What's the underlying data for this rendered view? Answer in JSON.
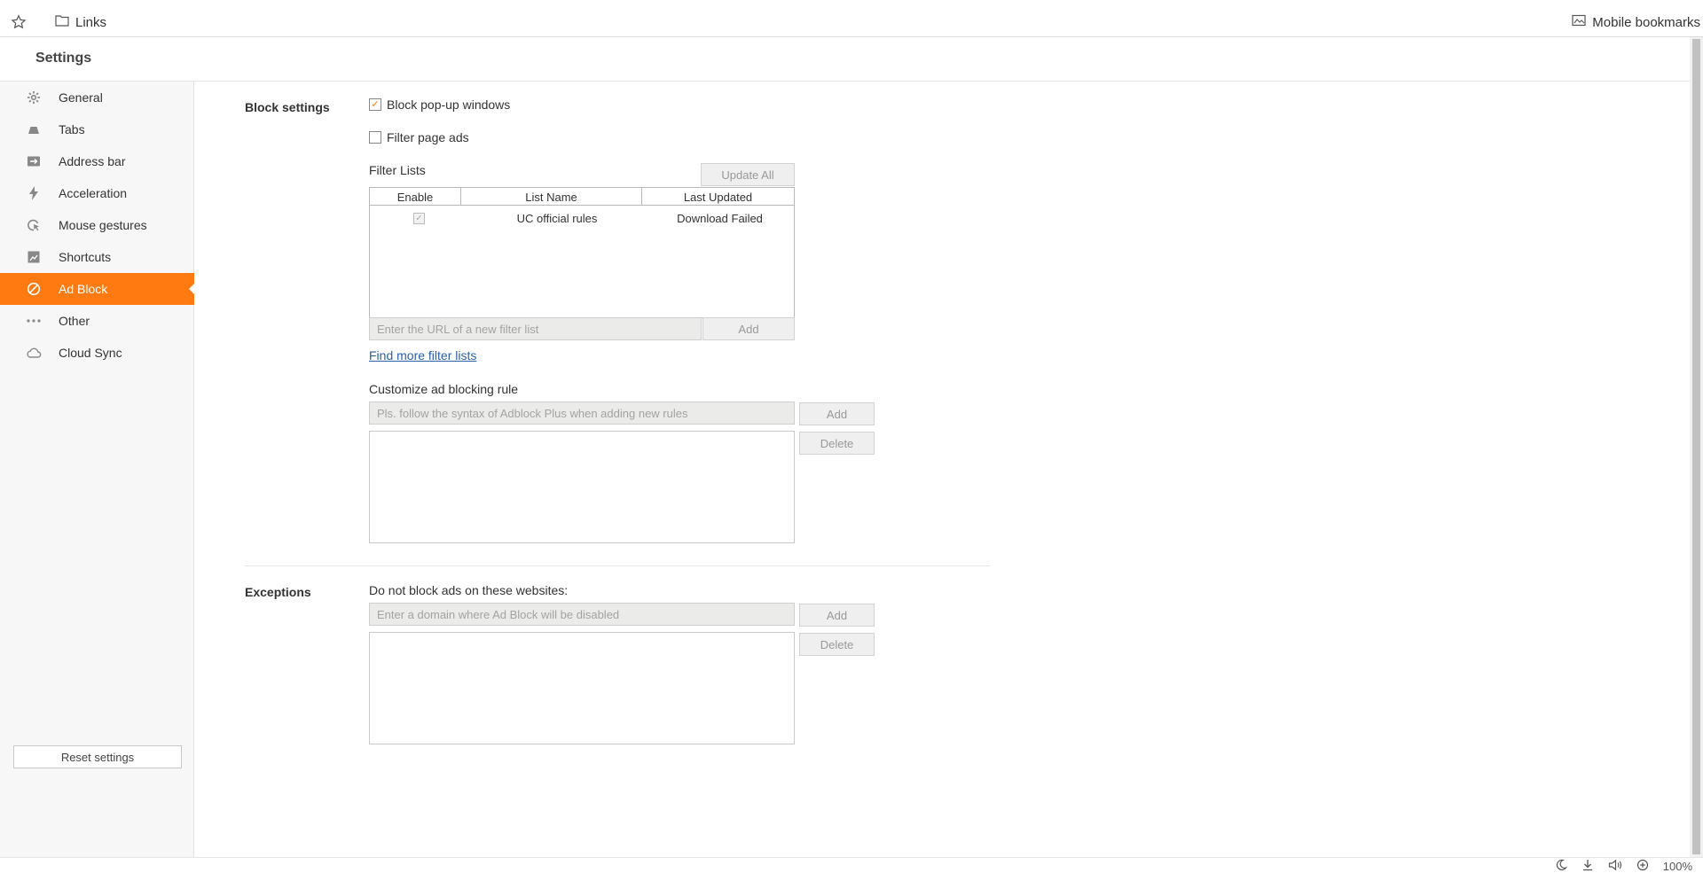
{
  "bookmarks_bar": {
    "links_label": "Links",
    "mobile_label": "Mobile bookmarks"
  },
  "settings": {
    "title": "Settings"
  },
  "sidebar": {
    "items": [
      {
        "label": "General",
        "icon": "gear-icon"
      },
      {
        "label": "Tabs",
        "icon": "tabs-icon"
      },
      {
        "label": "Address bar",
        "icon": "address-bar-icon"
      },
      {
        "label": "Acceleration",
        "icon": "lightning-icon"
      },
      {
        "label": "Mouse gestures",
        "icon": "mouse-gesture-icon"
      },
      {
        "label": "Shortcuts",
        "icon": "shortcuts-icon"
      },
      {
        "label": "Ad Block",
        "icon": "block-icon",
        "active": true
      },
      {
        "label": "Other",
        "icon": "more-icon"
      },
      {
        "label": "Cloud Sync",
        "icon": "cloud-icon"
      }
    ],
    "reset_label": "Reset settings"
  },
  "block_settings": {
    "title": "Block settings",
    "popup_label": "Block pop-up windows",
    "popup_checked": true,
    "filter_ads_label": "Filter page ads",
    "filter_ads_checked": false,
    "filter_lists_label": "Filter Lists",
    "update_all_label": "Update All",
    "table": {
      "headers": [
        "Enable",
        "List Name",
        "Last Updated"
      ],
      "rows": [
        {
          "enabled": true,
          "name": "UC official rules",
          "updated": "Download Failed"
        }
      ]
    },
    "url_placeholder": "Enter the URL of a new filter list",
    "add_label": "Add",
    "find_more_label": "Find more filter lists",
    "customize_label": "Customize ad blocking rule",
    "rule_placeholder": "Pls. follow the syntax of Adblock Plus when adding new rules",
    "rule_add_label": "Add",
    "rule_delete_label": "Delete"
  },
  "exceptions": {
    "title": "Exceptions",
    "description": "Do not block ads on these websites:",
    "domain_placeholder": "Enter a domain where Ad Block will be disabled",
    "add_label": "Add",
    "delete_label": "Delete"
  },
  "status_bar": {
    "zoom": "100%"
  },
  "colors": {
    "accent": "#ff7a10",
    "link": "#2a5fa8"
  }
}
